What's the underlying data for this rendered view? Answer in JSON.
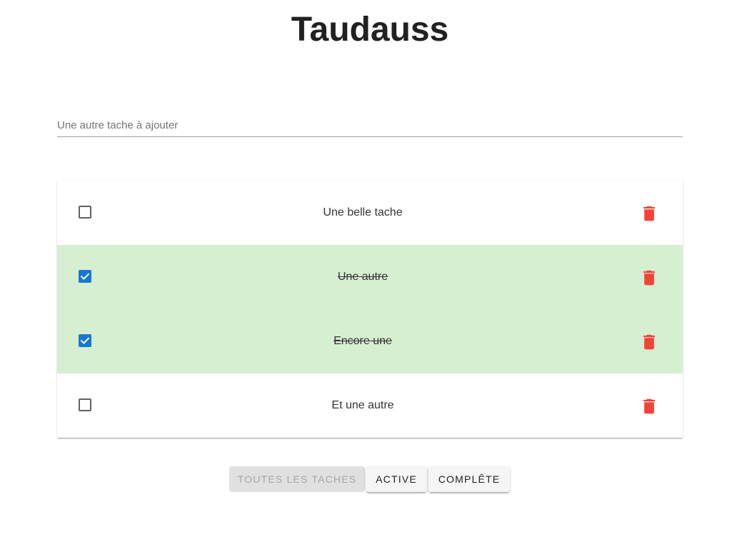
{
  "app": {
    "title": "Taudauss"
  },
  "new_task": {
    "placeholder": "Une autre tache à ajouter",
    "value": ""
  },
  "tasks": [
    {
      "label": "Une belle tache",
      "completed": false
    },
    {
      "label": "Une autre",
      "completed": true
    },
    {
      "label": "Encore une",
      "completed": true
    },
    {
      "label": "Et une autre",
      "completed": false
    }
  ],
  "filters": {
    "all_label": "Toutes les taches",
    "active_label": "Active",
    "completed_label": "Complête",
    "selected": "all"
  },
  "colors": {
    "completed_row": "#d6efd1",
    "checkbox_checked": "#1976d2",
    "delete_icon": "#f44336"
  },
  "icons": {
    "delete": "trash-icon",
    "checked": "check-icon",
    "unchecked": "checkbox-empty-icon"
  }
}
